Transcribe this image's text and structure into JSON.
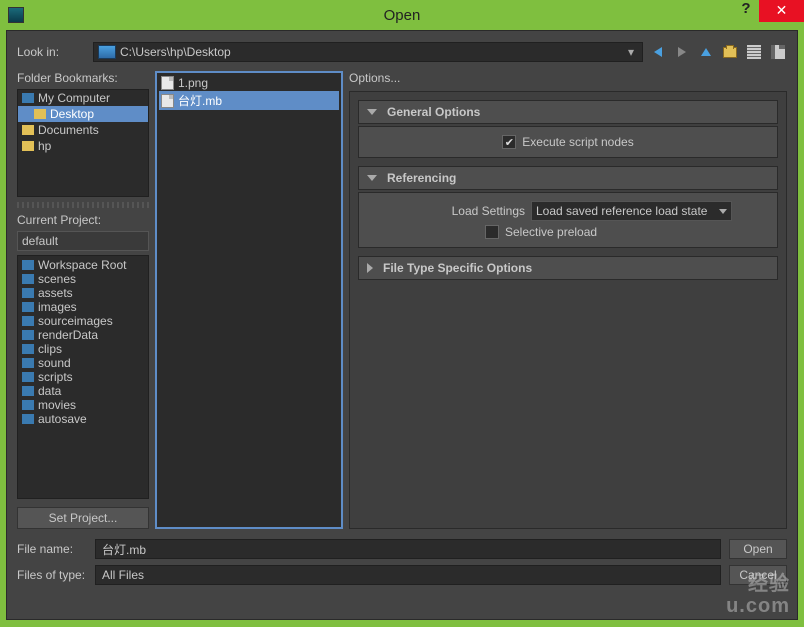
{
  "title": "Open",
  "lookin": {
    "label": "Look in:",
    "path": "C:\\Users\\hp\\Desktop"
  },
  "bookmarks": {
    "header": "Folder Bookmarks:",
    "items": [
      {
        "label": "My Computer",
        "indent": false,
        "icon": "computer"
      },
      {
        "label": "Desktop",
        "indent": true,
        "icon": "folder",
        "selected": true
      },
      {
        "label": "Documents",
        "indent": false,
        "icon": "folder"
      },
      {
        "label": "hp",
        "indent": false,
        "icon": "folder"
      }
    ]
  },
  "project": {
    "header": "Current Project:",
    "value": "default",
    "setBtn": "Set Project..."
  },
  "workspace": [
    "Workspace Root",
    "scenes",
    "assets",
    "images",
    "sourceimages",
    "renderData",
    "clips",
    "sound",
    "scripts",
    "data",
    "movies",
    "autosave"
  ],
  "files": [
    {
      "name": "1.png",
      "selected": false
    },
    {
      "name": "台灯.mb",
      "selected": true
    }
  ],
  "options": {
    "header": "Options...",
    "general": {
      "title": "General Options",
      "execScript": "Execute script nodes",
      "execChecked": true
    },
    "referencing": {
      "title": "Referencing",
      "loadLabel": "Load Settings",
      "loadValue": "Load saved reference load state",
      "selPreload": "Selective preload",
      "selChecked": false
    },
    "fileType": {
      "title": "File Type Specific Options"
    }
  },
  "filename": {
    "label": "File name:",
    "value": "台灯.mb",
    "btn": "Open"
  },
  "filetype": {
    "label": "Files of type:",
    "value": "All Files",
    "btn": "Cancel"
  },
  "watermark": {
    "line1": "经验",
    "line2": "u.com"
  }
}
